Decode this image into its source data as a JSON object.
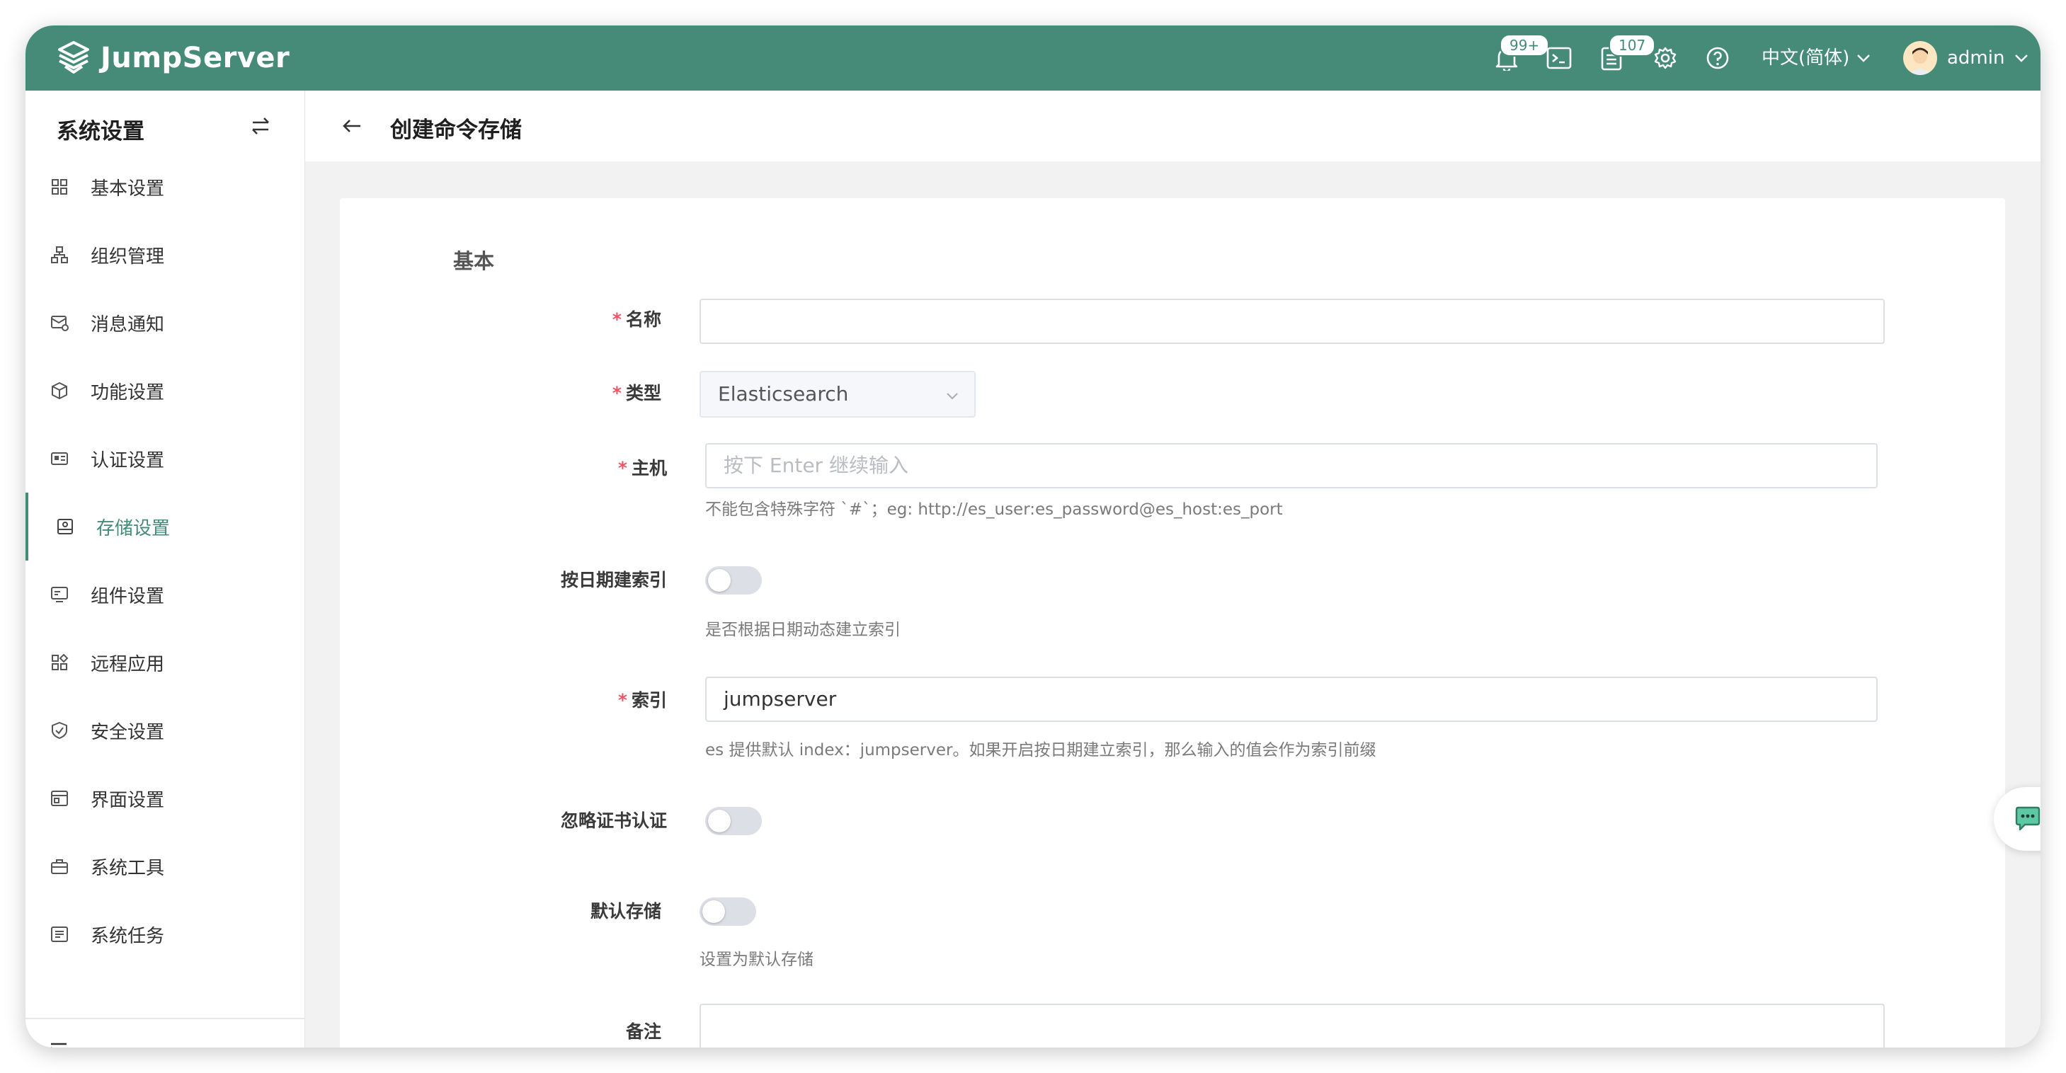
{
  "header": {
    "logo_text": "JumpServer",
    "notifications_badge": "99+",
    "tickets_badge": "107",
    "language": "中文(简体)",
    "username": "admin"
  },
  "sidebar": {
    "title": "系统设置",
    "items": [
      {
        "label": "基本设置",
        "icon": "grid-icon"
      },
      {
        "label": "组织管理",
        "icon": "org-tree-icon"
      },
      {
        "label": "消息通知",
        "icon": "message-icon"
      },
      {
        "label": "功能设置",
        "icon": "cube-icon"
      },
      {
        "label": "认证设置",
        "icon": "id-card-icon"
      },
      {
        "label": "存储设置",
        "icon": "storage-icon",
        "active": true
      },
      {
        "label": "组件设置",
        "icon": "monitor-icon"
      },
      {
        "label": "远程应用",
        "icon": "apps-icon"
      },
      {
        "label": "安全设置",
        "icon": "shield-icon"
      },
      {
        "label": "界面设置",
        "icon": "window-icon"
      },
      {
        "label": "系统工具",
        "icon": "toolbox-icon"
      },
      {
        "label": "系统任务",
        "icon": "task-list-icon"
      }
    ]
  },
  "page": {
    "title": "创建命令存储",
    "section": "基本"
  },
  "form": {
    "name": {
      "label": "名称",
      "value": ""
    },
    "type": {
      "label": "类型",
      "value": "Elasticsearch"
    },
    "host": {
      "label": "主机",
      "placeholder": "按下 Enter 继续输入",
      "help": "不能包含特殊字符 `#`；eg: http://es_user:es_password@es_host:es_port"
    },
    "date_index": {
      "label": "按日期建索引",
      "help": "是否根据日期动态建立索引",
      "enabled": false
    },
    "index": {
      "label": "索引",
      "value": "jumpserver",
      "help": "es 提供默认 index：jumpserver。如果开启按日期建立索引，那么输入的值会作为索引前缀"
    },
    "ignore_cert": {
      "label": "忽略证书认证",
      "enabled": false
    },
    "default_storage": {
      "label": "默认存储",
      "help": "设置为默认存储",
      "enabled": false
    },
    "comment": {
      "label": "备注",
      "value": ""
    }
  },
  "colors": {
    "brand": "#468b77",
    "required": "#ed5565"
  }
}
